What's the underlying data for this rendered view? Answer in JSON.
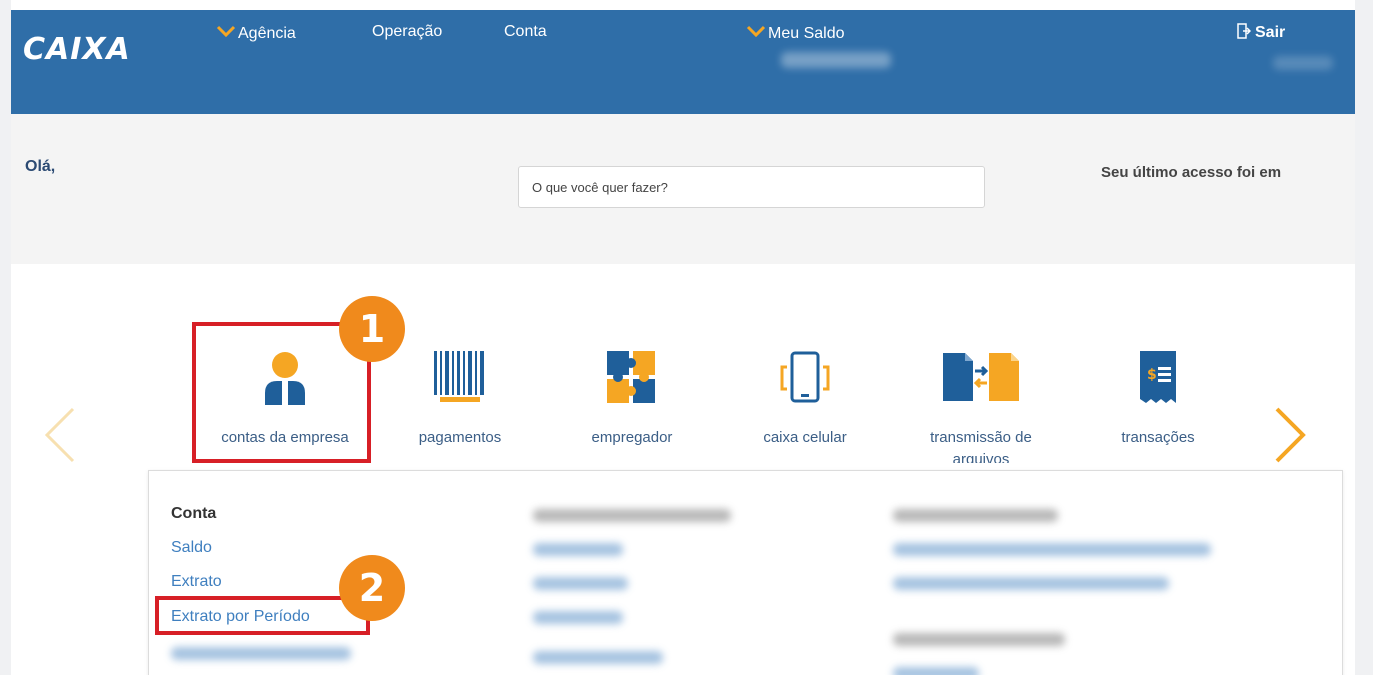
{
  "header": {
    "logo": "CAIXA",
    "nav": [
      "Agência",
      "Operação",
      "Conta"
    ],
    "saldo_label": "Meu Saldo",
    "logout_label": "Sair"
  },
  "greeting": {
    "hello": "Olá,",
    "search_placeholder": "O que você quer fazer?",
    "last_access": "Seu último acesso foi em"
  },
  "categories": [
    {
      "label": "contas da empresa",
      "icon": "user-icon"
    },
    {
      "label": "pagamentos",
      "icon": "barcode-icon"
    },
    {
      "label": "empregador",
      "icon": "puzzle-icon"
    },
    {
      "label": "caixa celular",
      "icon": "mobile-icon"
    },
    {
      "label": "transmissão de arquivos",
      "icon": "file-transfer-icon"
    },
    {
      "label": "transações",
      "icon": "receipt-icon"
    }
  ],
  "menu": {
    "section_title": "Conta",
    "items": [
      "Saldo",
      "Extrato",
      "Extrato por Período"
    ]
  },
  "annotations": [
    "1",
    "2"
  ],
  "colors": {
    "header_bg": "#2f6ea8",
    "accent_orange": "#f5a623",
    "link_blue": "#3f7fbf",
    "highlight_red": "#d71f26",
    "badge_orange": "#f08a1c"
  }
}
